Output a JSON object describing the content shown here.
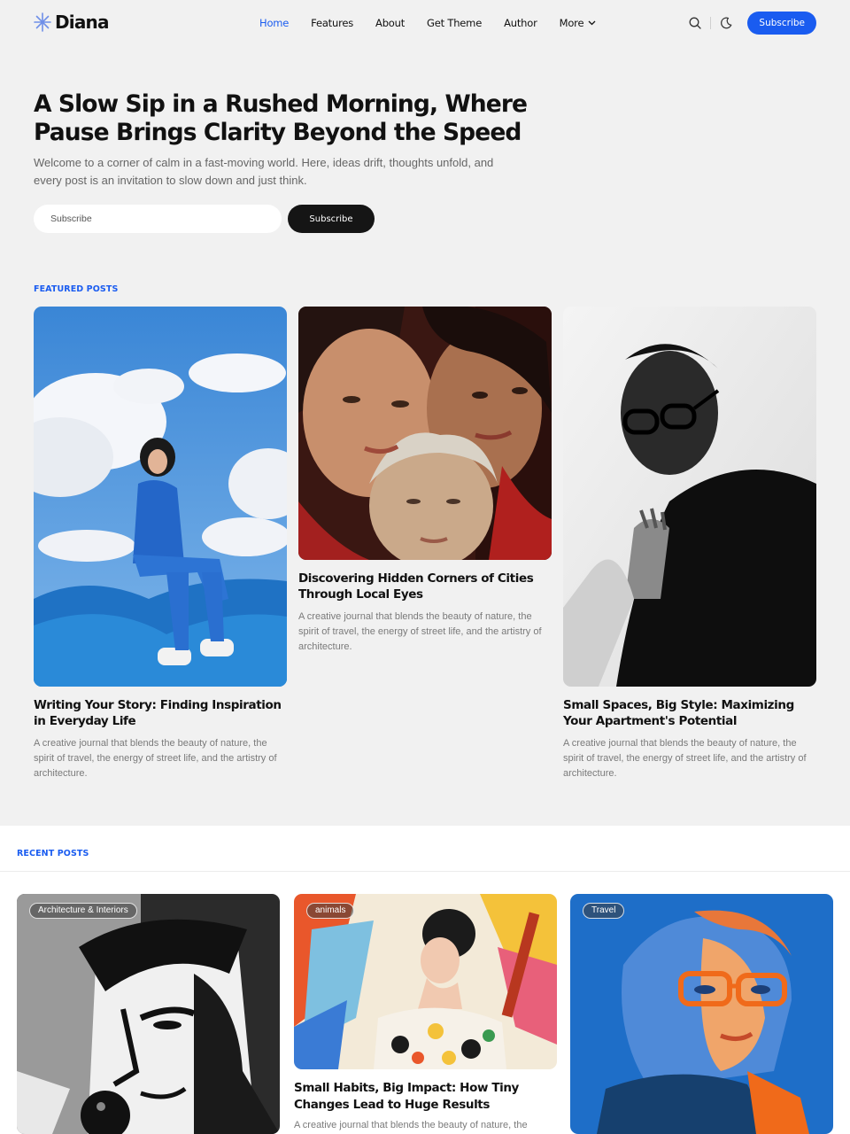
{
  "brand": {
    "name": "Diana",
    "logo_icon": "asterisk-burst-icon",
    "accent": "#1a5cf0"
  },
  "nav": {
    "items": [
      {
        "label": "Home",
        "active": true
      },
      {
        "label": "Features"
      },
      {
        "label": "About"
      },
      {
        "label": "Get Theme"
      },
      {
        "label": "Author"
      },
      {
        "label": "More",
        "has_dropdown": true
      }
    ]
  },
  "header_tools": {
    "search_icon": "search-icon",
    "theme_icon": "moon-icon",
    "subscribe_label": "Subscribe"
  },
  "hero": {
    "title": "A Slow Sip in a Rushed Morning, Where Pause Brings Clarity Beyond the Speed",
    "subtitle": "Welcome to a corner of calm in a fast-moving world. Here, ideas drift, thoughts unfold, and every post is an invitation to slow down and just think.",
    "input_placeholder": "Subscribe",
    "button_label": "Subscribe"
  },
  "featured": {
    "label": "FEATURED POSTS",
    "posts": [
      {
        "title": "Writing Your Story: Finding Inspiration in Everyday Life",
        "excerpt": "A creative journal that blends the beauty of nature, the spirit of travel, the energy of street life, and the artistry of architecture."
      },
      {
        "title": "Discovering Hidden Corners of Cities Through Local Eyes",
        "excerpt": "A creative journal that blends the beauty of nature, the spirit of travel, the energy of street life, and the artistry of architecture."
      },
      {
        "title": "Small Spaces, Big Style: Maximizing Your Apartment's Potential",
        "excerpt": "A creative journal that blends the beauty of nature, the spirit of travel, the energy of street life, and the artistry of architecture."
      }
    ]
  },
  "recent": {
    "label": "RECENT POSTS",
    "posts": [
      {
        "tag": "Architecture & Interiors"
      },
      {
        "tag": "animals",
        "title": "Small Habits, Big Impact: How Tiny Changes Lead to Huge Results",
        "excerpt": "A creative journal that blends the beauty of nature, the"
      },
      {
        "tag": "Travel"
      }
    ]
  }
}
